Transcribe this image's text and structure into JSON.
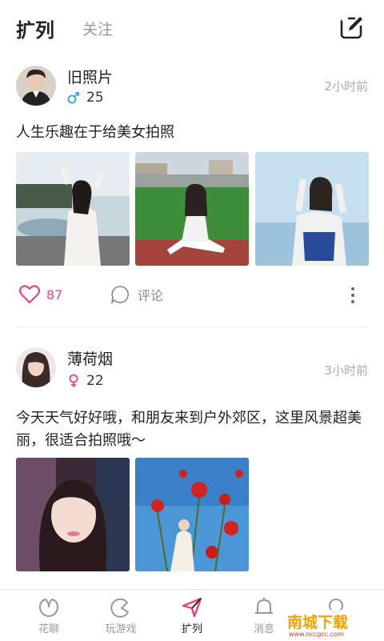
{
  "header": {
    "tab_active": "扩列",
    "tab_inactive": "关注",
    "edit_icon": "edit-icon"
  },
  "posts": [
    {
      "username": "旧照片",
      "gender": "male",
      "age": "25",
      "time": "2小时前",
      "content": "人生乐趣在于给美女拍照",
      "likes": "87",
      "comment_label": "评论"
    },
    {
      "username": "薄荷烟",
      "gender": "female",
      "age": "22",
      "time": "3小时前",
      "content": "今天天气好好哦，和朋友来到户外郊区，这里风景超美丽，很适合拍照哦～"
    }
  ],
  "tabbar": {
    "items": [
      {
        "label": "花聊",
        "icon": "flower-icon"
      },
      {
        "label": "玩游戏",
        "icon": "game-icon"
      },
      {
        "label": "扩列",
        "icon": "send-icon"
      },
      {
        "label": "消息",
        "icon": "bell-icon"
      },
      {
        "label": "",
        "icon": "profile-icon"
      }
    ]
  },
  "watermark": {
    "title": "南城下载",
    "url": "www.nccgcc.com"
  },
  "colors": {
    "accent": "#e8447a",
    "male": "#3aa0e8",
    "female": "#e8447a",
    "text_secondary": "#999999"
  }
}
